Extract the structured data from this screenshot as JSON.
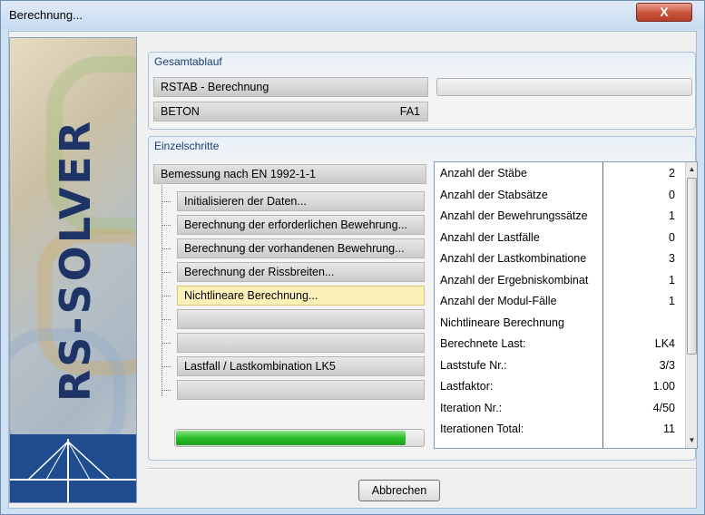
{
  "window": {
    "title": "Berechnung...",
    "close_label": "X"
  },
  "banner": {
    "brand": "RS-SOLVER"
  },
  "overall": {
    "title": "Gesamtablauf",
    "row1": "RSTAB - Berechnung",
    "row2": "BETON",
    "row2_tag": "FA1",
    "progress": 0.0
  },
  "steps": {
    "title": "Einzelschritte",
    "root": "Bemessung nach EN 1992-1-1",
    "items": [
      {
        "label": "Initialisieren der Daten..."
      },
      {
        "label": "Berechnung der erforderlichen Bewehrung..."
      },
      {
        "label": "Berechnung der vorhandenen Bewehrung..."
      },
      {
        "label": "Berechnung der Rissbreiten..."
      },
      {
        "label": "Nichtlineare Berechnung..."
      },
      {
        "label": ""
      },
      {
        "label": ""
      },
      {
        "label": "Lastfall / Lastkombination LK5"
      },
      {
        "label": ""
      }
    ],
    "progress": 0.93
  },
  "stats": [
    {
      "label": "Anzahl der Stäbe",
      "value": "2"
    },
    {
      "label": "Anzahl der Stabsätze",
      "value": "0"
    },
    {
      "label": "Anzahl der Bewehrungssätze",
      "value": "1"
    },
    {
      "label": "Anzahl der Lastfälle",
      "value": "0"
    },
    {
      "label": "Anzahl der Lastkombinatione",
      "value": "3"
    },
    {
      "label": "Anzahl der Ergebniskombinat",
      "value": "1"
    },
    {
      "label": "Anzahl der Modul-Fälle",
      "value": "1"
    },
    {
      "label": "Nichtlineare Berechnung",
      "value": ""
    },
    {
      "label": "Berechnete Last:",
      "value": "LK4"
    },
    {
      "label": "Laststufe Nr.:",
      "value": "3/3"
    },
    {
      "label": "Lastfaktor:",
      "value": "1.00"
    },
    {
      "label": "Iteration Nr.:",
      "value": "4/50"
    },
    {
      "label": "Iterationen Total:",
      "value": "11"
    }
  ],
  "footer": {
    "cancel_label": "Abbrechen"
  }
}
